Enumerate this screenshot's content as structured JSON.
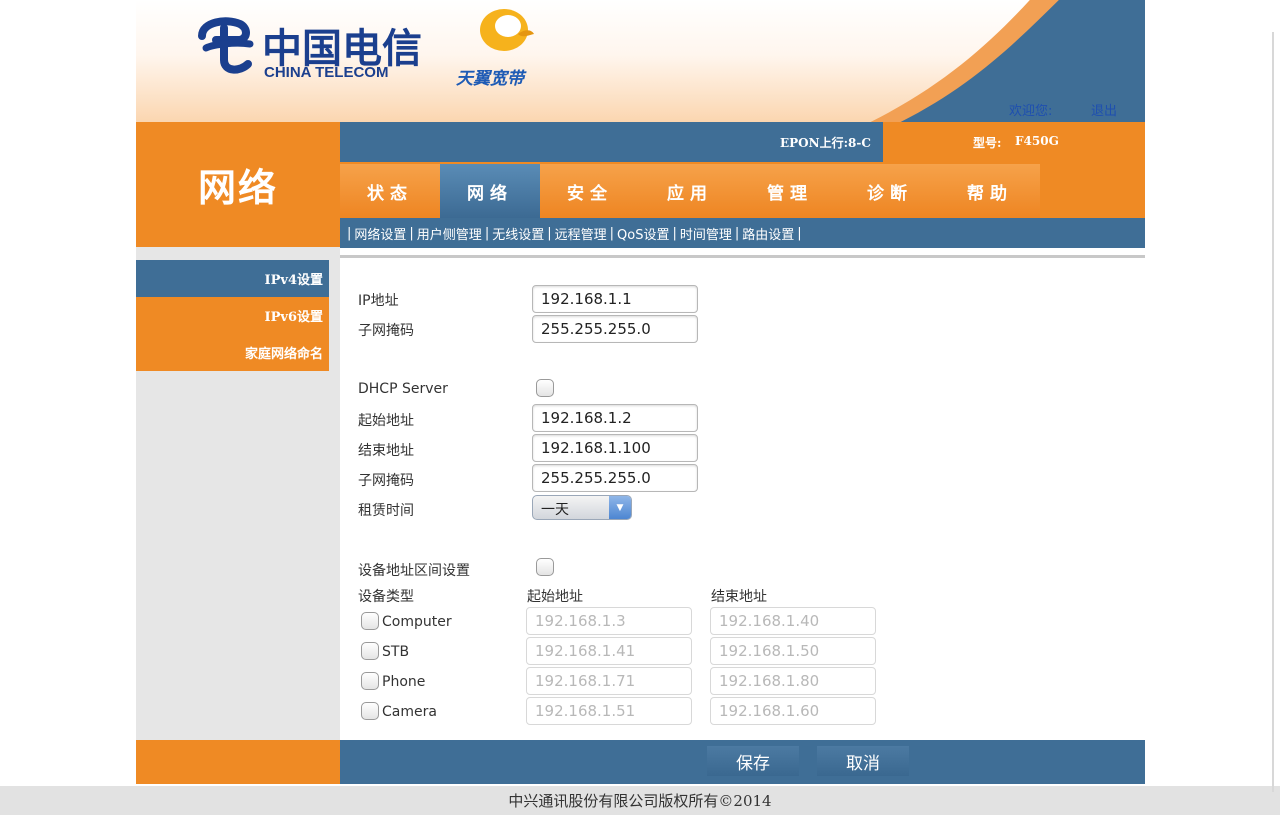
{
  "header": {
    "logo_cn": "中国电信",
    "logo_en": "CHINA TELECOM",
    "brand": "天翼宽带",
    "welcome": "欢迎您:",
    "logout": "退出"
  },
  "section_title": "网络",
  "infobar": {
    "epon": "EPON上行:8-C",
    "model_label": "型号:",
    "model_value": "F450G"
  },
  "nav": {
    "tabs": [
      "状态",
      "网络",
      "安全",
      "应用",
      "管理",
      "诊断",
      "帮助"
    ],
    "active": "网络"
  },
  "subnav": [
    "网络设置",
    "用户侧管理",
    "无线设置",
    "远程管理",
    "QoS设置",
    "时间管理",
    "路由设置"
  ],
  "sidebar": {
    "items": [
      "IPv4设置",
      "IPv6设置",
      "家庭网络命名"
    ]
  },
  "form": {
    "ip_label": "IP地址",
    "ip_value": "192.168.1.1",
    "mask_label": "子网掩码",
    "mask_value": "255.255.255.0",
    "dhcp_label": "DHCP Server",
    "start_label": "起始地址",
    "start_value": "192.168.1.2",
    "end_label": "结束地址",
    "end_value": "192.168.1.100",
    "dhcp_mask_label": "子网掩码",
    "dhcp_mask_value": "255.255.255.0",
    "lease_label": "租赁时间",
    "lease_value": "一天",
    "range_label": "设备地址区间设置",
    "col_type": "设备类型",
    "col_start": "起始地址",
    "col_end": "结束地址",
    "devices": [
      {
        "name": "Computer",
        "start": "192.168.1.3",
        "end": "192.168.1.40"
      },
      {
        "name": "STB",
        "start": "192.168.1.41",
        "end": "192.168.1.50"
      },
      {
        "name": "Phone",
        "start": "192.168.1.71",
        "end": "192.168.1.80"
      },
      {
        "name": "Camera",
        "start": "192.168.1.51",
        "end": "192.168.1.60"
      }
    ]
  },
  "footer": {
    "save": "保存",
    "cancel": "取消",
    "copyright": "中兴通讯股份有限公司版权所有©2014"
  },
  "colors": {
    "orange": "#ef8a24",
    "blue": "#3f6e96",
    "logo_blue": "#1b3f8e",
    "sidebar_active": "#3f6e96"
  }
}
